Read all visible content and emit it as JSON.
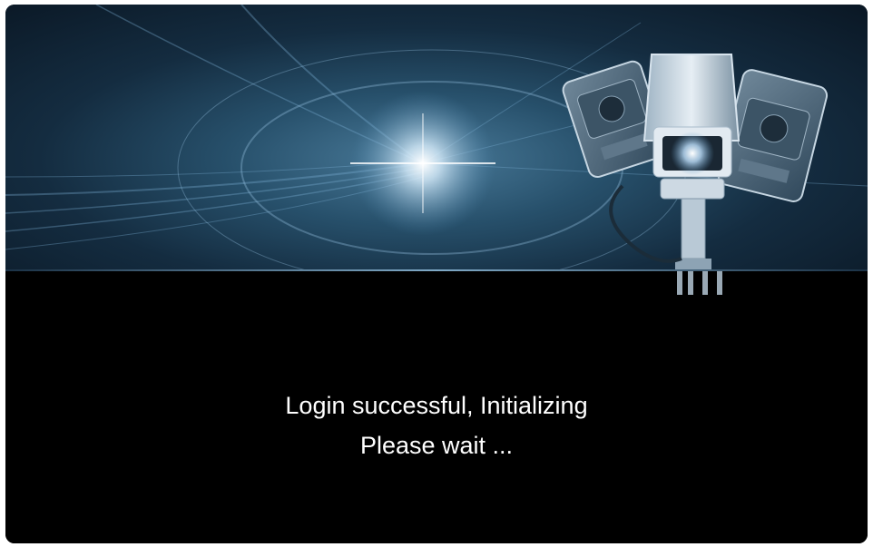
{
  "splash": {
    "status_line": "Login successful, Initializing",
    "wait_line": "Please wait ...",
    "banner_icon": "security-camera-icon"
  },
  "colors": {
    "banner_base": "#27506b",
    "background": "#000000",
    "text": "#ffffff"
  }
}
